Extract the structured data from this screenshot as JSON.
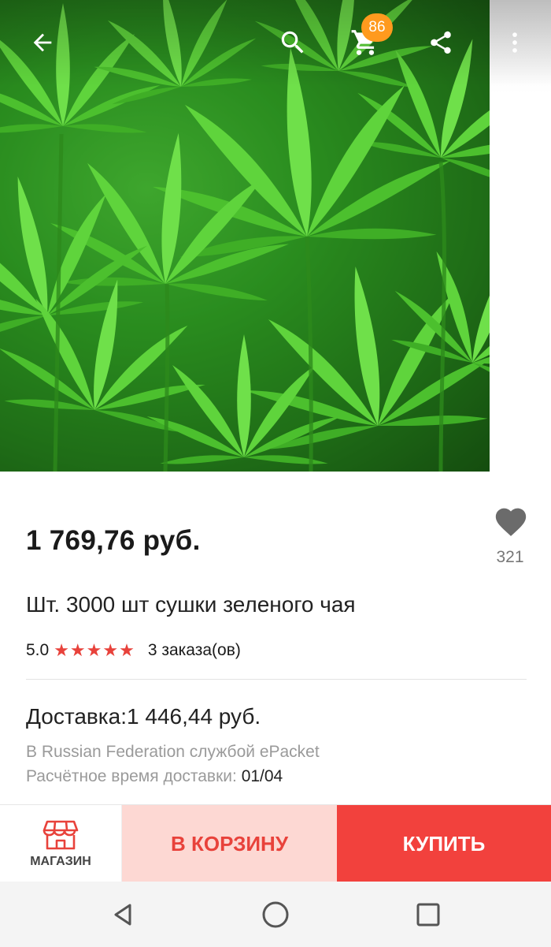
{
  "toolbar": {
    "cart_count": "86"
  },
  "icons": {
    "back": "arrow-back-icon",
    "search": "search-icon",
    "cart": "cart-icon",
    "share": "share-icon",
    "more": "more-vertical-icon",
    "wish": "heart-icon",
    "store": "storefront-icon"
  },
  "product": {
    "price": "1 769,76 руб.",
    "title": "Шт. 3000 шт сушки зеленого чая",
    "rating": "5.0",
    "stars": "★★★★★",
    "orders": "3 заказа(ов)",
    "wish_count": "321"
  },
  "shipping": {
    "cost_label": "Доставка:1 446,44 руб.",
    "method": "В Russian Federation службой ePacket",
    "eta_label": "Расчётное время доставки: ",
    "eta_value": "01/04"
  },
  "actions": {
    "store_label": "МАГАЗИН",
    "add_to_cart_label": "В КОРЗИНУ",
    "buy_label": "КУПИТЬ"
  },
  "colors": {
    "accent_red": "#f2413d",
    "cart_button_bg": "#fdd8d3",
    "star_color": "#e8423b",
    "badge_orange": "#ff9a1e"
  }
}
